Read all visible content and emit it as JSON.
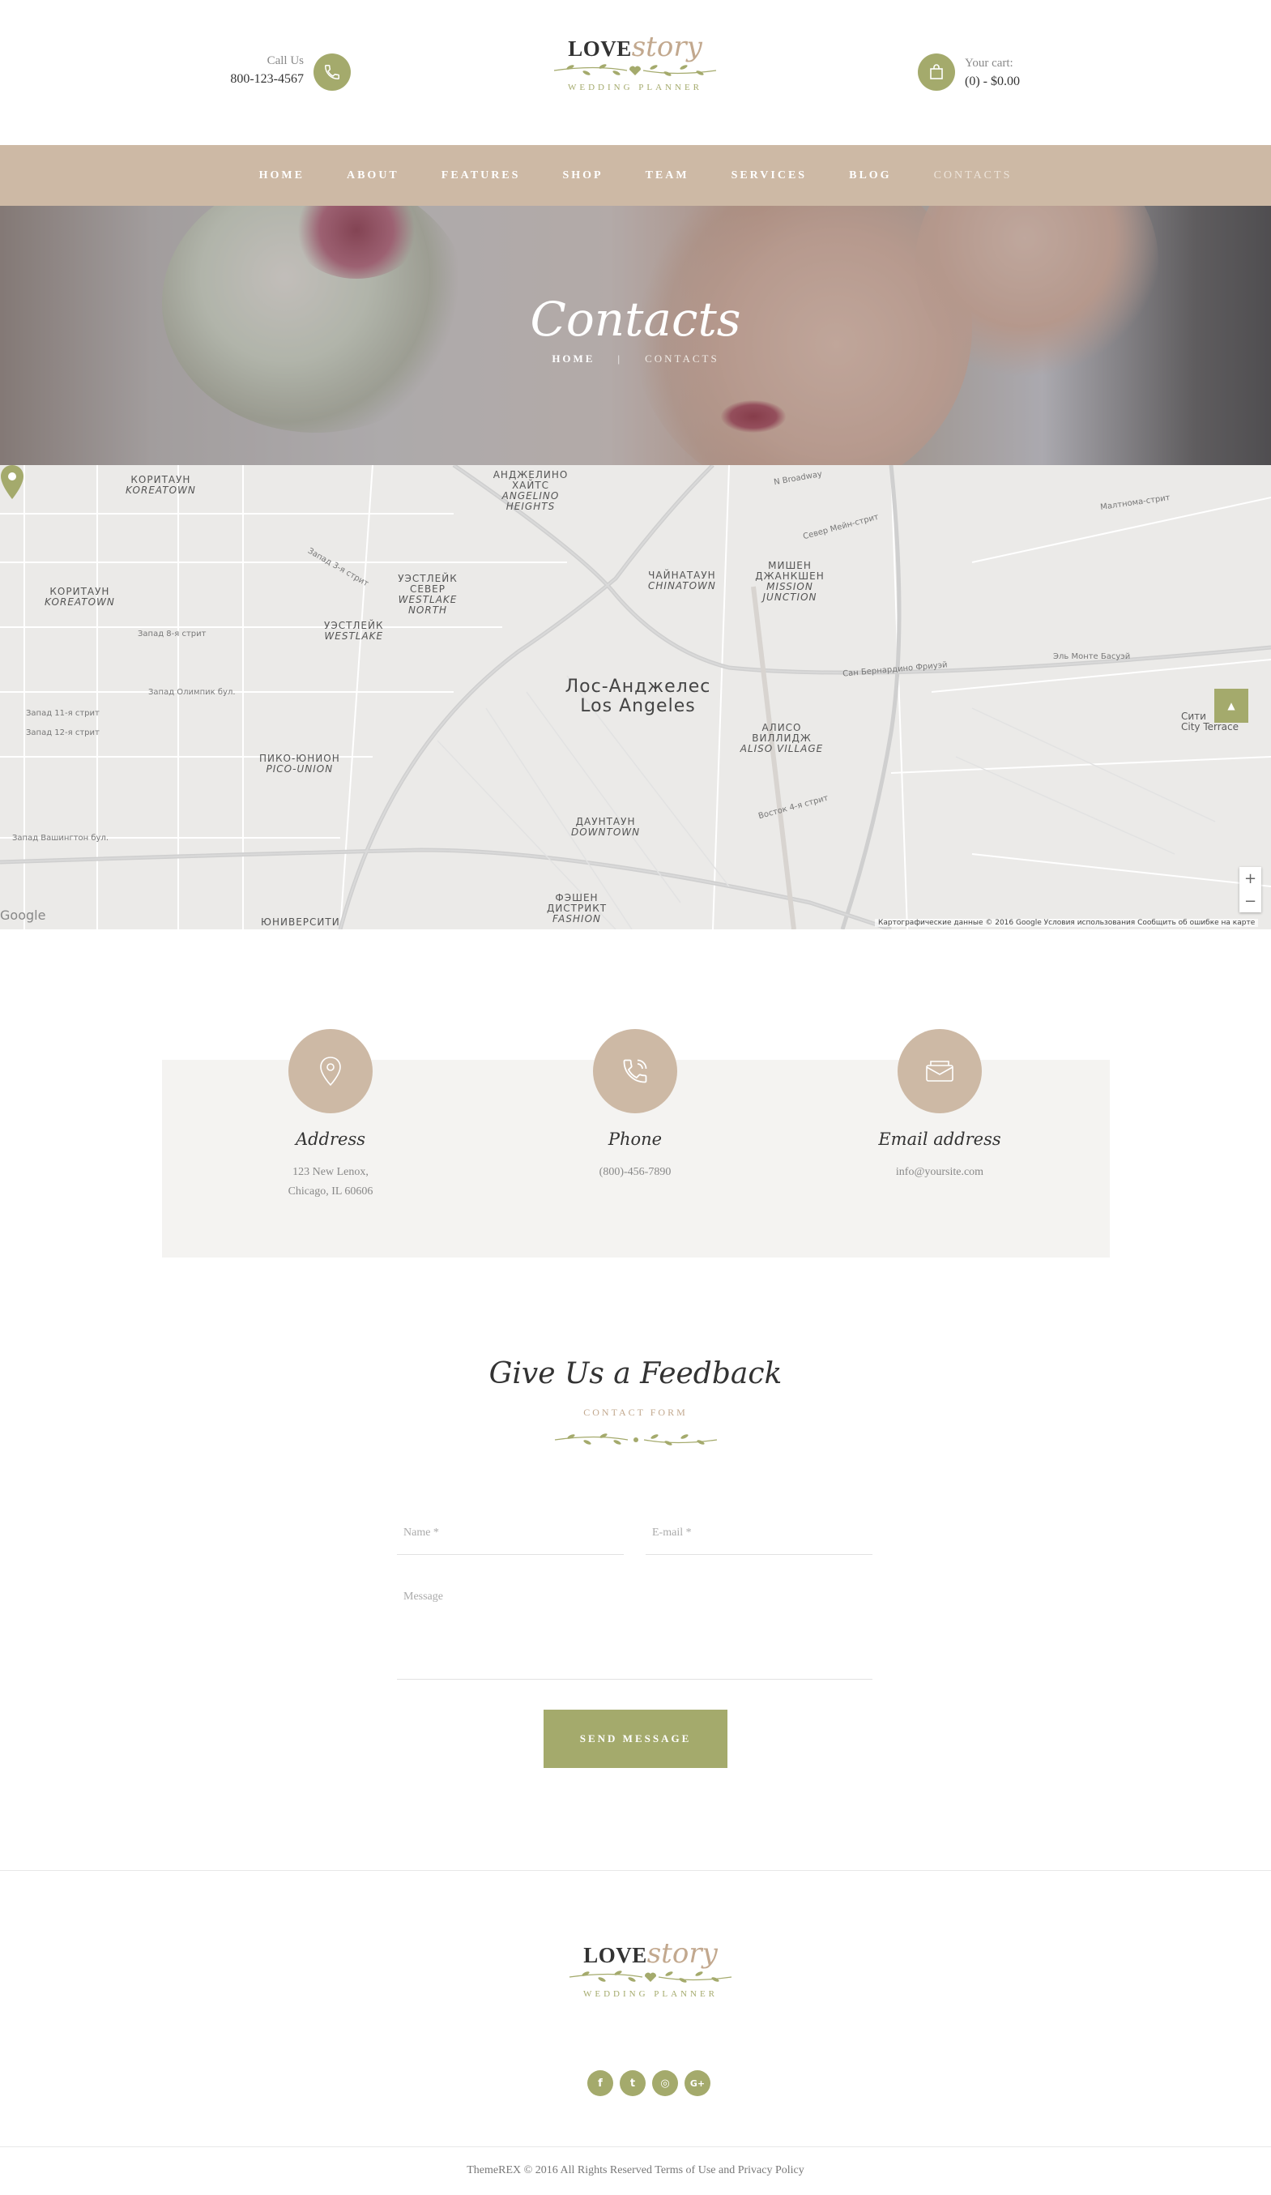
{
  "header": {
    "call_label": "Call Us",
    "call_number": "800-123-4567",
    "cart_label": "Your cart:",
    "cart_value": "(0) - $0.00",
    "phone_icon": "phone-icon",
    "cart_icon": "shopping-bag-icon"
  },
  "logo": {
    "love": "LOVE",
    "story": "story",
    "subtitle": "WEDDING PLANNER"
  },
  "nav": {
    "items": [
      "HOME",
      "ABOUT",
      "FEATURES",
      "SHOP",
      "TEAM",
      "SERVICES",
      "BLOG",
      "CONTACTS"
    ],
    "active": "CONTACTS"
  },
  "hero": {
    "title": "Contacts",
    "breadcrumb_home": "HOME",
    "breadcrumb_sep": "|",
    "breadcrumb_current": "CONTACTS"
  },
  "map": {
    "city_ru": "Лос-Анджелес",
    "city_en": "Los Angeles",
    "labels": {
      "koreatown_top_ru": "КОРИТАУН",
      "koreatown_top_en": "KOREATOWN",
      "angelino_ru": "АНДЖЕЛИНО ХАЙТС",
      "angelino_en": "ANGELINO HEIGHTS",
      "westlake_n_ru": "УЭСТЛЕЙК СЕВЕР",
      "westlake_n_en": "WESTLAKE NORTH",
      "chinatown_ru": "ЧАЙНАТАУН",
      "chinatown_en": "CHINATOWN",
      "mission_ru": "МИШЕН ДЖАНКШЕН",
      "mission_en": "MISSION JUNCTION",
      "koreatown_ru": "КОРИТАУН",
      "koreatown_en": "KOREATOWN",
      "westlake_ru": "УЭСТЛЕЙК",
      "westlake_en": "WESTLAKE",
      "aliso_ru": "АЛИСО ВИЛЛИДЖ",
      "aliso_en": "ALISO VILLAGE",
      "pico_ru": "ПИКО-ЮНИОН",
      "pico_en": "PICO-UNION",
      "downtown_ru": "ДАУНТАУН",
      "downtown_en": "DOWNTOWN",
      "fashion_ru": "ФЭШЕН ДИСТРИКТ",
      "fashion_en": "FASHION",
      "university_ru": "ЮНИВЕРСИТИ",
      "city_terrace_ru": "Сити",
      "city_terrace_en": "City Terrace"
    },
    "streets": [
      "Запад 3-я стрит",
      "Запад 8-я стрит",
      "Запад Олимпик бул.",
      "Запад 11-я стрит",
      "Запад 12-я стрит",
      "Запад Вашингтон бул.",
      "Север Мейн-стрит",
      "Восток 4-я стрит",
      "Сан Бернардино Фриуэй",
      "Эль Монте Басуэй",
      "Малтнома-стрит",
      "N Broadway"
    ],
    "footer": "Картографические данные © 2016 Google   Условия использования   Сообщить об ошибке на карте",
    "google": "Google",
    "zoom_in": "+",
    "zoom_out": "−"
  },
  "contact_info": [
    {
      "title": "Address",
      "line1": "123 New Lenox,",
      "line2": "Chicago, IL 60606",
      "icon": "map-pin-icon"
    },
    {
      "title": "Phone",
      "line1": "(800)-456-7890",
      "line2": "",
      "icon": "phone-icon"
    },
    {
      "title": "Email address",
      "line1": "info@yoursite.com",
      "line2": "",
      "icon": "envelope-icon"
    }
  ],
  "feedback": {
    "title": "Give Us a Feedback",
    "subtitle": "CONTACT FORM",
    "name_placeholder": "Name *",
    "email_placeholder": "E-mail *",
    "message_placeholder": "Message",
    "send_label": "SEND MESSAGE"
  },
  "footer": {
    "socials": [
      "facebook-icon",
      "twitter-icon",
      "instagram-icon",
      "google-plus-icon"
    ],
    "social_glyphs": [
      "f",
      "t",
      "◎",
      "G+"
    ],
    "copyright": "ThemeREX © 2016 All Rights Reserved Terms of Use and Privacy Policy"
  },
  "colors": {
    "accent_green": "#a4aa6c",
    "beige": "#cdb9a5",
    "story_tan": "#c2a88e"
  }
}
